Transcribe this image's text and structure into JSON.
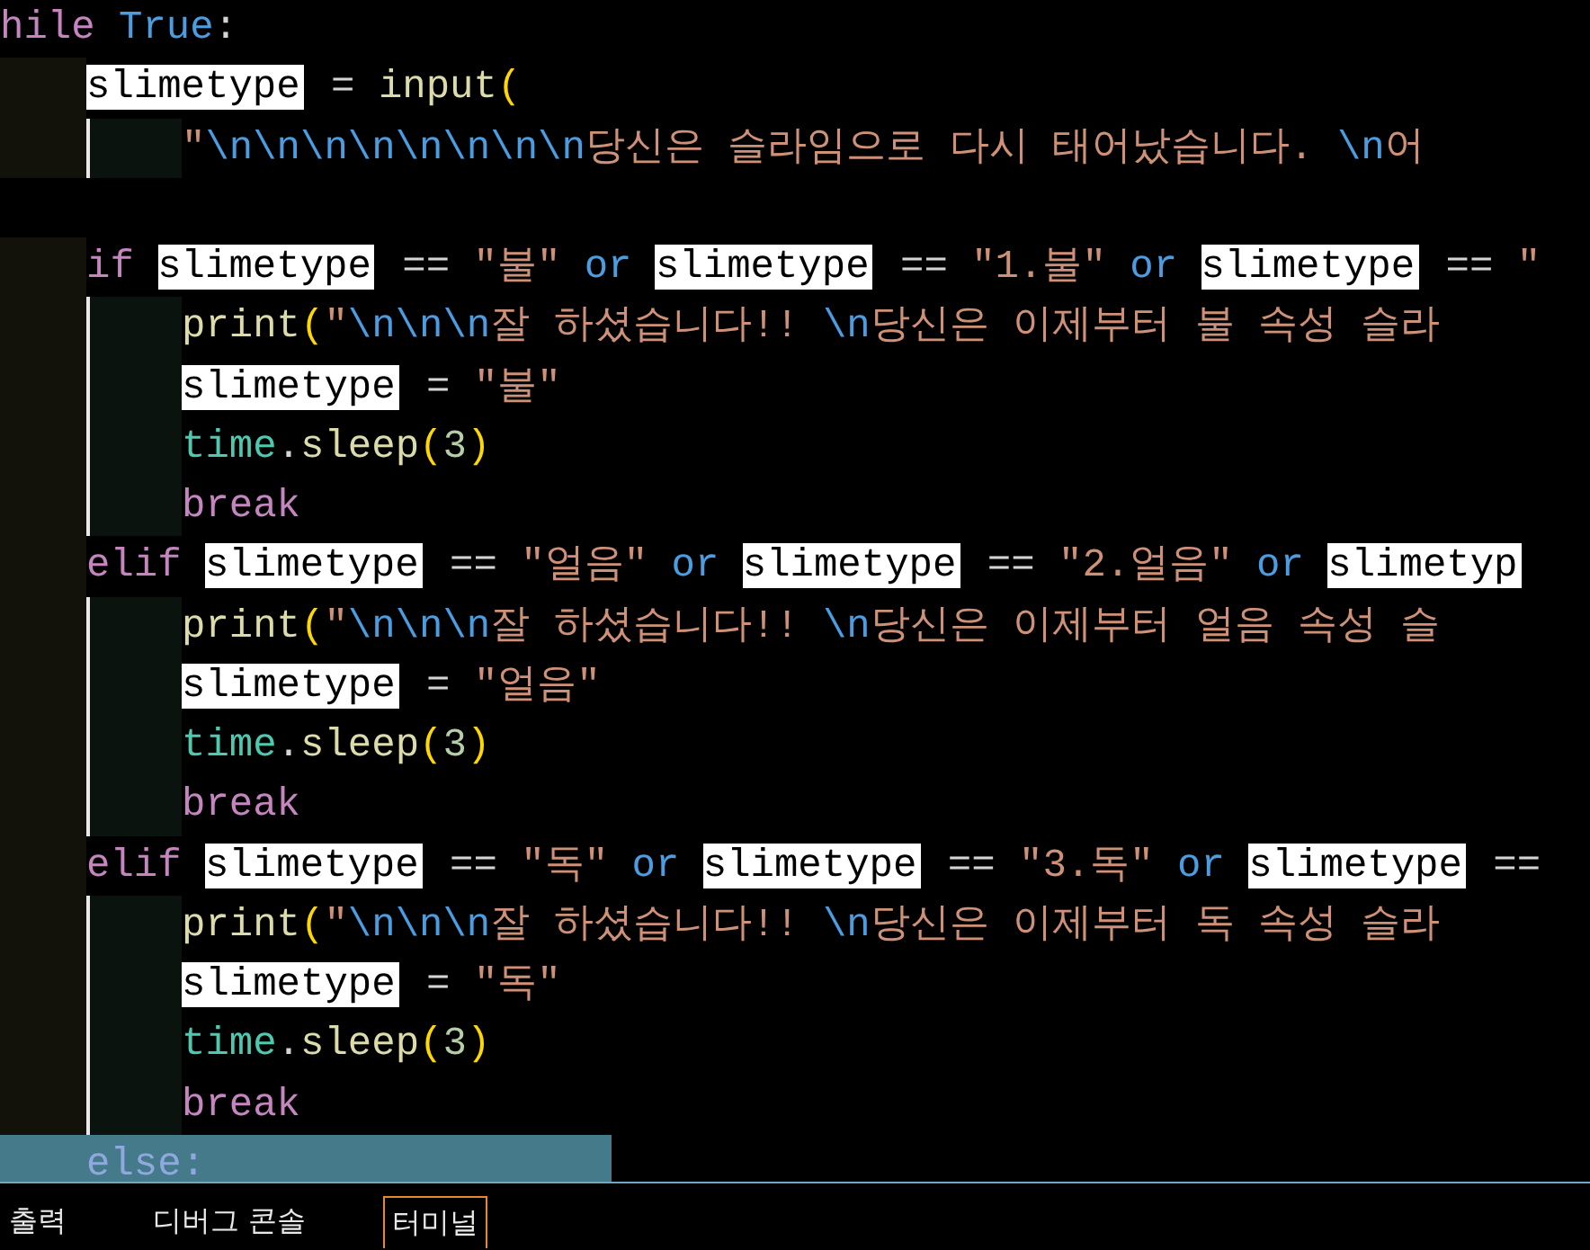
{
  "editor": {
    "lines": [
      {
        "kind": "code",
        "highlighted": false,
        "tokens": [
          {
            "kind": "kw",
            "text": "hile"
          },
          {
            "kind": "const",
            "text": " True"
          },
          {
            "kind": "op",
            "text": ":"
          }
        ],
        "children": [
          {
            "kind": "code",
            "highlighted": false,
            "tokens": [
              {
                "kind": "match",
                "text": "slimetype"
              },
              {
                "kind": "op",
                "text": " = "
              },
              {
                "kind": "fn",
                "text": "input"
              },
              {
                "kind": "paren",
                "text": "("
              }
            ],
            "children": [
              {
                "kind": "code",
                "highlighted": false,
                "tokens": [
                  {
                    "kind": "str",
                    "text": "\""
                  },
                  {
                    "kind": "esc",
                    "text": "\\n\\n\\n\\n\\n\\n\\n\\n"
                  },
                  {
                    "kind": "str",
                    "text": "당신은 슬라임으로 다시 태어났습니다. "
                  },
                  {
                    "kind": "esc",
                    "text": "\\n"
                  },
                  {
                    "kind": "str",
                    "text": "어"
                  }
                ]
              }
            ]
          },
          {
            "kind": "blank"
          },
          {
            "kind": "code",
            "highlighted": false,
            "tokens": [
              {
                "kind": "kw",
                "text": "if "
              },
              {
                "kind": "match",
                "text": "slimetype"
              },
              {
                "kind": "op",
                "text": " == "
              },
              {
                "kind": "str",
                "text": "\"불\""
              },
              {
                "kind": "const",
                "text": " or "
              },
              {
                "kind": "match",
                "text": "slimetype"
              },
              {
                "kind": "op",
                "text": " == "
              },
              {
                "kind": "str",
                "text": "\"1.불\""
              },
              {
                "kind": "const",
                "text": " or "
              },
              {
                "kind": "match",
                "text": "slimetype"
              },
              {
                "kind": "op",
                "text": " == "
              },
              {
                "kind": "str",
                "text": "\""
              }
            ],
            "children": [
              {
                "kind": "code",
                "highlighted": false,
                "tokens": [
                  {
                    "kind": "fn",
                    "text": "print"
                  },
                  {
                    "kind": "paren",
                    "text": "("
                  },
                  {
                    "kind": "str",
                    "text": "\""
                  },
                  {
                    "kind": "esc",
                    "text": "\\n\\n\\n"
                  },
                  {
                    "kind": "str",
                    "text": "잘 하셨습니다!! "
                  },
                  {
                    "kind": "esc",
                    "text": "\\n"
                  },
                  {
                    "kind": "str",
                    "text": "당신은 이제부터 불 속성 슬라"
                  }
                ]
              },
              {
                "kind": "code",
                "highlighted": false,
                "tokens": [
                  {
                    "kind": "match",
                    "text": "slimetype"
                  },
                  {
                    "kind": "op",
                    "text": " = "
                  },
                  {
                    "kind": "str",
                    "text": "\"불\""
                  }
                ]
              },
              {
                "kind": "code",
                "highlighted": false,
                "tokens": [
                  {
                    "kind": "mod",
                    "text": "time"
                  },
                  {
                    "kind": "op",
                    "text": "."
                  },
                  {
                    "kind": "fn",
                    "text": "sleep"
                  },
                  {
                    "kind": "paren",
                    "text": "("
                  },
                  {
                    "kind": "num",
                    "text": "3"
                  },
                  {
                    "kind": "paren",
                    "text": ")"
                  }
                ]
              },
              {
                "kind": "code",
                "highlighted": false,
                "tokens": [
                  {
                    "kind": "kw",
                    "text": "break"
                  }
                ]
              }
            ]
          },
          {
            "kind": "code",
            "highlighted": false,
            "tokens": [
              {
                "kind": "kw",
                "text": "elif "
              },
              {
                "kind": "match",
                "text": "slimetype"
              },
              {
                "kind": "op",
                "text": " == "
              },
              {
                "kind": "str",
                "text": "\"얼음\""
              },
              {
                "kind": "const",
                "text": " or "
              },
              {
                "kind": "match",
                "text": "slimetype"
              },
              {
                "kind": "op",
                "text": " == "
              },
              {
                "kind": "str",
                "text": "\"2.얼음\""
              },
              {
                "kind": "const",
                "text": " or "
              },
              {
                "kind": "match",
                "text": "slimetyp"
              }
            ],
            "children": [
              {
                "kind": "code",
                "highlighted": false,
                "tokens": [
                  {
                    "kind": "fn",
                    "text": "print"
                  },
                  {
                    "kind": "paren",
                    "text": "("
                  },
                  {
                    "kind": "str",
                    "text": "\""
                  },
                  {
                    "kind": "esc",
                    "text": "\\n\\n\\n"
                  },
                  {
                    "kind": "str",
                    "text": "잘 하셨습니다!! "
                  },
                  {
                    "kind": "esc",
                    "text": "\\n"
                  },
                  {
                    "kind": "str",
                    "text": "당신은 이제부터 얼음 속성 슬"
                  }
                ]
              },
              {
                "kind": "code",
                "highlighted": false,
                "tokens": [
                  {
                    "kind": "match",
                    "text": "slimetype"
                  },
                  {
                    "kind": "op",
                    "text": " = "
                  },
                  {
                    "kind": "str",
                    "text": "\"얼음\""
                  }
                ]
              },
              {
                "kind": "code",
                "highlighted": false,
                "tokens": [
                  {
                    "kind": "mod",
                    "text": "time"
                  },
                  {
                    "kind": "op",
                    "text": "."
                  },
                  {
                    "kind": "fn",
                    "text": "sleep"
                  },
                  {
                    "kind": "paren",
                    "text": "("
                  },
                  {
                    "kind": "num",
                    "text": "3"
                  },
                  {
                    "kind": "paren",
                    "text": ")"
                  }
                ]
              },
              {
                "kind": "code",
                "highlighted": false,
                "tokens": [
                  {
                    "kind": "kw",
                    "text": "break"
                  }
                ]
              }
            ]
          },
          {
            "kind": "code",
            "highlighted": false,
            "tokens": [
              {
                "kind": "kw",
                "text": "elif "
              },
              {
                "kind": "match",
                "text": "slimetype"
              },
              {
                "kind": "op",
                "text": " == "
              },
              {
                "kind": "str",
                "text": "\"독\""
              },
              {
                "kind": "const",
                "text": " or "
              },
              {
                "kind": "match",
                "text": "slimetype"
              },
              {
                "kind": "op",
                "text": " == "
              },
              {
                "kind": "str",
                "text": "\"3.독\""
              },
              {
                "kind": "const",
                "text": " or "
              },
              {
                "kind": "match",
                "text": "slimetype"
              },
              {
                "kind": "op",
                "text": " =="
              }
            ],
            "children": [
              {
                "kind": "code",
                "highlighted": false,
                "tokens": [
                  {
                    "kind": "fn",
                    "text": "print"
                  },
                  {
                    "kind": "paren",
                    "text": "("
                  },
                  {
                    "kind": "str",
                    "text": "\""
                  },
                  {
                    "kind": "esc",
                    "text": "\\n\\n\\n"
                  },
                  {
                    "kind": "str",
                    "text": "잘 하셨습니다!! "
                  },
                  {
                    "kind": "esc",
                    "text": "\\n"
                  },
                  {
                    "kind": "str",
                    "text": "당신은 이제부터 독 속성 슬라"
                  }
                ]
              },
              {
                "kind": "code",
                "highlighted": false,
                "tokens": [
                  {
                    "kind": "match",
                    "text": "slimetype"
                  },
                  {
                    "kind": "op",
                    "text": " = "
                  },
                  {
                    "kind": "str",
                    "text": "\"독\""
                  }
                ]
              },
              {
                "kind": "code",
                "highlighted": false,
                "tokens": [
                  {
                    "kind": "mod",
                    "text": "time"
                  },
                  {
                    "kind": "op",
                    "text": "."
                  },
                  {
                    "kind": "fn",
                    "text": "sleep"
                  },
                  {
                    "kind": "paren",
                    "text": "("
                  },
                  {
                    "kind": "num",
                    "text": "3"
                  },
                  {
                    "kind": "paren",
                    "text": ")"
                  }
                ]
              },
              {
                "kind": "code",
                "highlighted": false,
                "tokens": [
                  {
                    "kind": "kw",
                    "text": "break"
                  }
                ]
              }
            ]
          },
          {
            "kind": "code",
            "highlighted": true,
            "tokens": [
              {
                "kind": "kw",
                "text": "else"
              },
              {
                "kind": "op",
                "text": ":"
              }
            ]
          }
        ]
      }
    ]
  },
  "panel": {
    "tabs": [
      {
        "label": "출력",
        "selected": false
      },
      {
        "label": "디버그 콘솔",
        "selected": false
      },
      {
        "label": "터미널",
        "selected": true
      }
    ]
  }
}
